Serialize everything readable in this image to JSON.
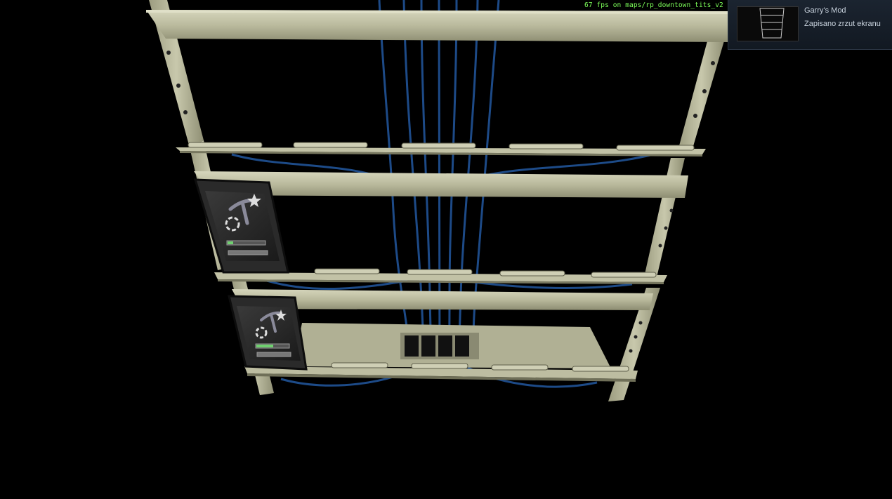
{
  "hud": {
    "fps_text": "67 fps on maps/rp_downtown_tits_v2"
  },
  "notification": {
    "app_name": "Garry's Mod",
    "message": "Zapisano zrzut ekranu",
    "thumbnail_icon": "screenshot-thumbnail"
  },
  "scene": {
    "object": "printer-rack",
    "printers": [
      {
        "icon": "pickaxe-icon",
        "badge": "1"
      },
      {
        "icon": "pickaxe-icon",
        "badge": "1"
      }
    ],
    "colors": {
      "rack": "#b8b89a",
      "cable": "#1f4f8f",
      "fps_text": "#7dff5a"
    }
  }
}
